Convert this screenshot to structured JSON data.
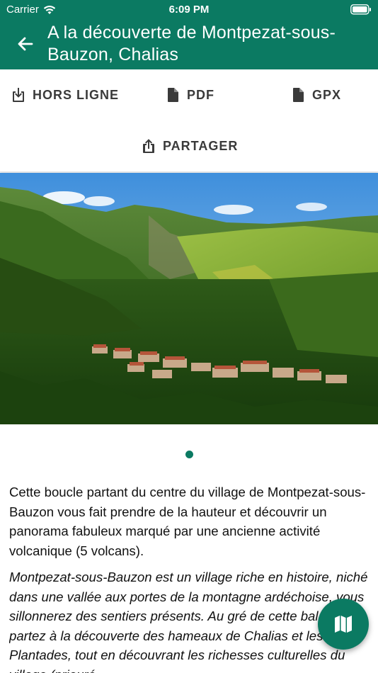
{
  "status_bar": {
    "carrier": "Carrier",
    "time": "6:09 PM"
  },
  "header": {
    "title": "A la découverte de Montpezat-sous-Bauzon, Chalias"
  },
  "actions": {
    "offline_label": "HORS LIGNE",
    "pdf_label": "PDF",
    "gpx_label": "GPX",
    "share_label": "PARTAGER"
  },
  "carousel": {
    "page_count": 1,
    "current_page": 1
  },
  "description": {
    "intro": "Cette boucle partant du centre du village de Montpezat-sous-Bauzon vous fait prendre de la hauteur et découvrir un panorama fabuleux marqué par une ancienne activité volcanique (5 volcans).",
    "body": "Montpezat-sous-Bauzon est un village riche en histoire, niché dans une vallée aux portes de la montagne ardéchoise, vous sillonnerez des sentiers présents. Au gré de cette balade, partez à la découverte des hameaux de Chalias et les Plantades, tout en découvrant les richesses culturelles du village (prieuré"
  },
  "icons": {
    "back": "arrow-left-icon",
    "offline": "download-icon",
    "pdf": "file-icon",
    "gpx": "file-icon",
    "share": "share-icon",
    "map": "map-icon"
  },
  "colors": {
    "primary": "#0b7a62",
    "text": "#111111",
    "action_text": "#3a3a3a"
  }
}
